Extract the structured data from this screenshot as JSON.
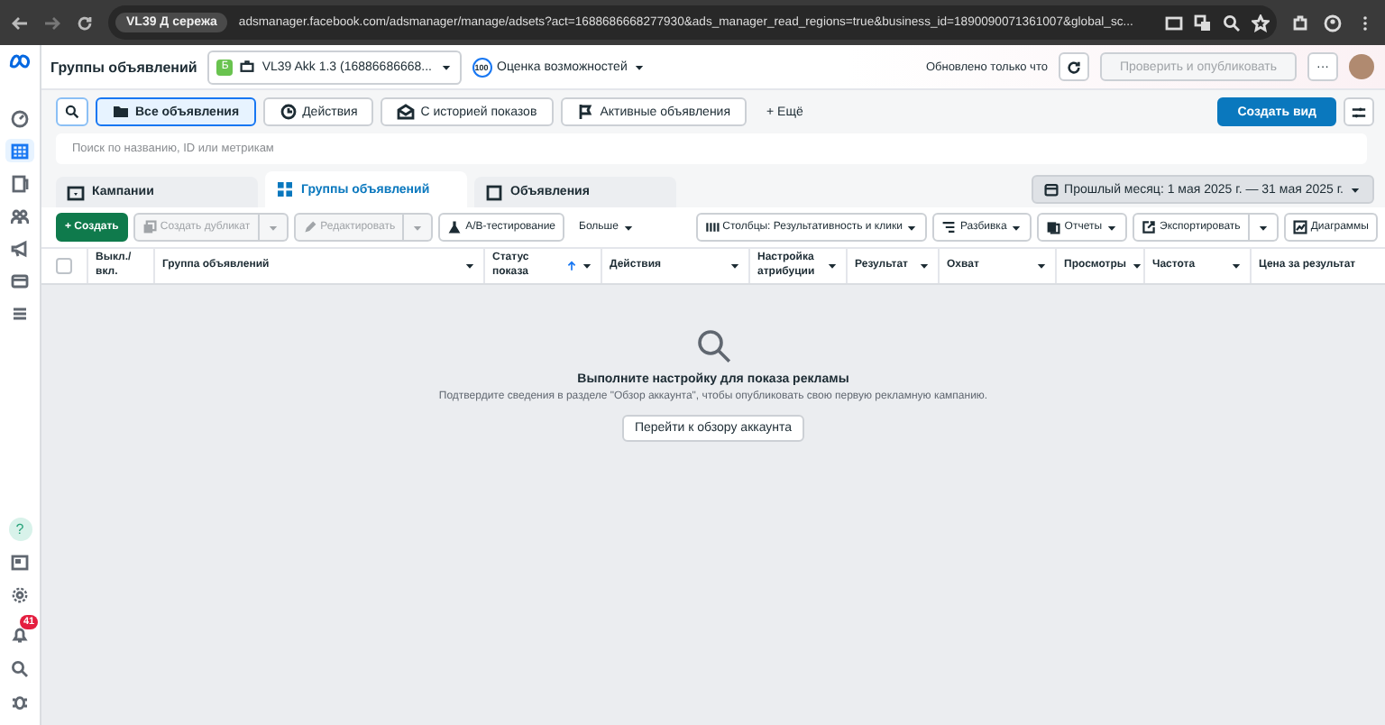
{
  "browser": {
    "profile_chip": "VL39 Д сережа",
    "url": "adsmanager.facebook.com/adsmanager/manage/adsets?act=1688686668277930&ads_manager_read_regions=true&business_id=1890090071361007&global_sc..."
  },
  "header": {
    "title": "Группы объявлений",
    "account_badge": "Б",
    "account": "VL39 Akk 1.3 (16886686668...",
    "score": "100",
    "score_label": "Оценка возможностей",
    "updated": "Обновлено только что",
    "publish": {
      "label": "Проверить и опубликовать",
      "disabled": true
    },
    "more": "···"
  },
  "views": [
    {
      "label": "Все объявления",
      "selected": true
    },
    {
      "label": "Действия",
      "selected": false
    },
    {
      "label": "С историей показов",
      "selected": false
    },
    {
      "label": "Активные объявления",
      "selected": false
    }
  ],
  "views_more": "+ Ещё",
  "create_view": "Создать вид",
  "search": {
    "placeholder": "Поиск по названию, ID или метрикам"
  },
  "levels": [
    {
      "label": "Кампании",
      "selected": false
    },
    {
      "label": "Группы объявлений",
      "selected": true
    },
    {
      "label": "Объявления",
      "selected": false
    }
  ],
  "date_range": "Прошлый месяц: 1 мая 2025 г. — 31 мая 2025 г.",
  "toolbar": {
    "create": "+ Создать",
    "duplicate": {
      "label": "Создать дубликат",
      "disabled": true
    },
    "edit": {
      "label": "Редактировать",
      "disabled": true
    },
    "ab_test": "A/B-тестирование",
    "more": "Больше",
    "columns": "Столбцы: Результативность и клики",
    "breakdown": "Разбивка",
    "reports": "Отчеты",
    "export": "Экспортировать",
    "charts": "Диаграммы"
  },
  "table": {
    "select_all": {
      "checked": false
    },
    "columns": [
      {
        "label": "Выкл./ вкл.",
        "sorted": false,
        "menu": false
      },
      {
        "label": "Группа объявлений",
        "sorted": false,
        "menu": true
      },
      {
        "label": "Статус показа",
        "sorted": true,
        "menu": true
      },
      {
        "label": "Действия",
        "sorted": false,
        "menu": true
      },
      {
        "label": "Настройка атрибуции",
        "sorted": false,
        "menu": true
      },
      {
        "label": "Результат",
        "sorted": false,
        "menu": true
      },
      {
        "label": "Охват",
        "sorted": false,
        "menu": true
      },
      {
        "label": "Просмотры",
        "sorted": false,
        "menu": true
      },
      {
        "label": "Частота",
        "sorted": false,
        "menu": true
      },
      {
        "label": "Цена за результат",
        "sorted": false,
        "menu": false
      }
    ]
  },
  "empty_state": {
    "title": "Выполните настройку для показа рекламы",
    "text": "Подтвердите сведения в разделе \"Обзор аккаунта\", чтобы опубликовать свою первую рекламную кампанию.",
    "button": "Перейти к обзору аккаунта"
  },
  "sidebar": {
    "help": "?",
    "notifications": "41"
  }
}
